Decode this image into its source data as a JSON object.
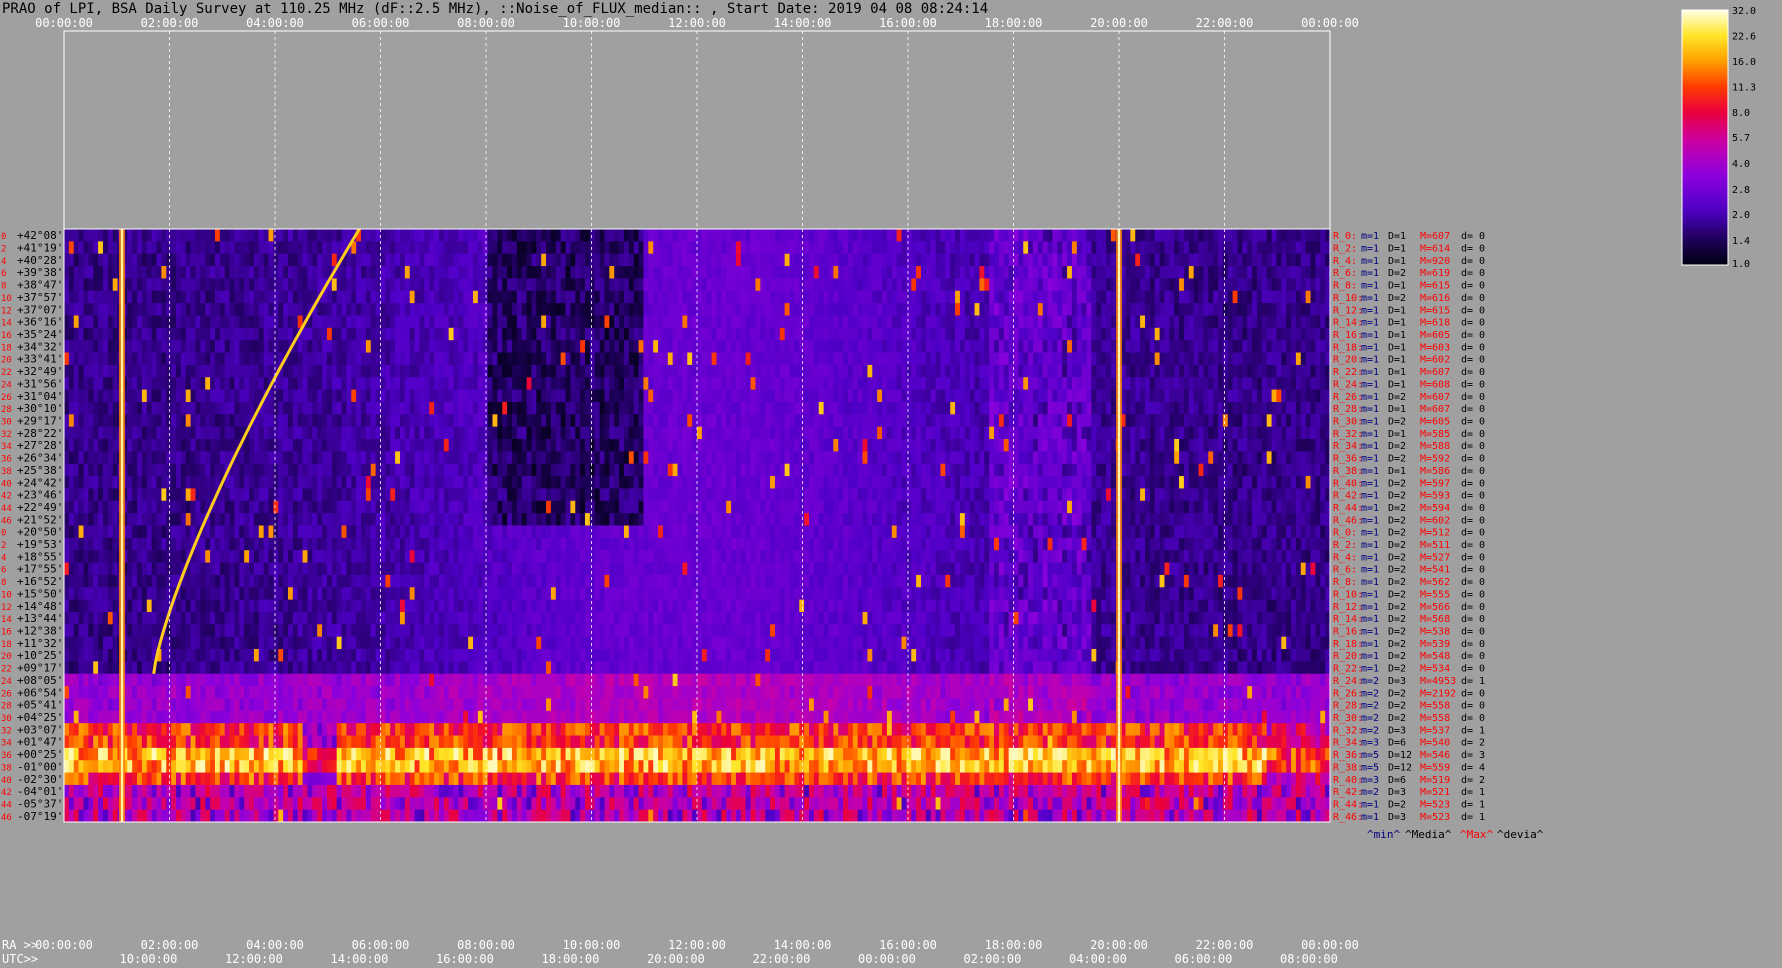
{
  "title": "PRAO of LPI, BSA Daily Survey at 110.25 MHz (dF::2.5 MHz), ::Noise_of_FLUX_median:: , Start Date: 2019 04 08 08:24:14",
  "chart_data": {
    "type": "heatmap",
    "title": "PRAO of LPI, BSA Daily Survey at 110.25 MHz (dF::2.5 MHz), ::Noise_of_FLUX_median:: , Start Date: 2019 04 08 08:24:14",
    "x_top_ticks": [
      "00:00:00",
      "02:00:00",
      "04:00:00",
      "06:00:00",
      "08:00:00",
      "10:00:00",
      "12:00:00",
      "14:00:00",
      "16:00:00",
      "18:00:00",
      "20:00:00",
      "22:00:00",
      "00:00:00"
    ],
    "ra_label": "RA >>",
    "ra_ticks": [
      "00:00:00",
      "02:00:00",
      "04:00:00",
      "06:00:00",
      "08:00:00",
      "10:00:00",
      "12:00:00",
      "14:00:00",
      "16:00:00",
      "18:00:00",
      "20:00:00",
      "22:00:00",
      "00:00:00"
    ],
    "utc_label": "UTC>>",
    "utc_ticks": [
      "10:00:00",
      "12:00:00",
      "14:00:00",
      "16:00:00",
      "18:00:00",
      "20:00:00",
      "22:00:00",
      "00:00:00",
      "02:00:00",
      "04:00:00",
      "06:00:00",
      "08:00:00"
    ],
    "row_index_labels": [
      "0",
      "2",
      "4",
      "6",
      "8",
      "10",
      "12",
      "14",
      "16",
      "18",
      "20",
      "22",
      "24",
      "26",
      "28",
      "30",
      "32",
      "34",
      "36",
      "38",
      "40",
      "42",
      "44",
      "46",
      "0",
      "2",
      "4",
      "6",
      "8",
      "10",
      "12",
      "14",
      "16",
      "18",
      "20",
      "22",
      "24",
      "26",
      "28",
      "30",
      "32",
      "34",
      "36",
      "38",
      "40",
      "42",
      "44",
      "46"
    ],
    "declinations": [
      "+42°08'",
      "+41°19'",
      "+40°28'",
      "+39°38'",
      "+38°47'",
      "+37°57'",
      "+37°07'",
      "+36°16'",
      "+35°24'",
      "+34°32'",
      "+33°41'",
      "+32°49'",
      "+31°56'",
      "+31°04'",
      "+30°10'",
      "+29°17'",
      "+28°22'",
      "+27°28'",
      "+26°34'",
      "+25°38'",
      "+24°42'",
      "+23°46'",
      "+22°49'",
      "+21°52'",
      "+20°50'",
      "+19°53'",
      "+18°55'",
      "+17°55'",
      "+16°52'",
      "+15°50'",
      "+14°48'",
      "+13°44'",
      "+12°38'",
      "+11°32'",
      "+10°25'",
      "+09°17'",
      "+08°05'",
      "+06°54'",
      "+05°41'",
      "+04°25'",
      "+03°07'",
      "+01°47'",
      "+00°25'",
      "-01°00'",
      "-02°30'",
      "-04°01'",
      "-05°37'",
      "-07°19'"
    ],
    "row_stats": [
      {
        "r": "R_0:",
        "m": "m=1",
        "D": "D=1",
        "M": "M=607",
        "d": "d= 0"
      },
      {
        "r": "R_2:",
        "m": "m=1",
        "D": "D=1",
        "M": "M=614",
        "d": "d= 0"
      },
      {
        "r": "R_4:",
        "m": "m=1",
        "D": "D=1",
        "M": "M=920",
        "d": "d= 0"
      },
      {
        "r": "R_6:",
        "m": "m=1",
        "D": "D=2",
        "M": "M=619",
        "d": "d= 0"
      },
      {
        "r": "R_8:",
        "m": "m=1",
        "D": "D=1",
        "M": "M=615",
        "d": "d= 0"
      },
      {
        "r": "R_10:",
        "m": "m=1",
        "D": "D=2",
        "M": "M=616",
        "d": "d= 0"
      },
      {
        "r": "R_12:",
        "m": "m=1",
        "D": "D=1",
        "M": "M=615",
        "d": "d= 0"
      },
      {
        "r": "R_14:",
        "m": "m=1",
        "D": "D=1",
        "M": "M=618",
        "d": "d= 0"
      },
      {
        "r": "R_16:",
        "m": "m=1",
        "D": "D=1",
        "M": "M=605",
        "d": "d= 0"
      },
      {
        "r": "R_18:",
        "m": "m=1",
        "D": "D=1",
        "M": "M=603",
        "d": "d= 0"
      },
      {
        "r": "R_20:",
        "m": "m=1",
        "D": "D=1",
        "M": "M=602",
        "d": "d= 0"
      },
      {
        "r": "R_22:",
        "m": "m=1",
        "D": "D=1",
        "M": "M=607",
        "d": "d= 0"
      },
      {
        "r": "R_24:",
        "m": "m=1",
        "D": "D=1",
        "M": "M=608",
        "d": "d= 0"
      },
      {
        "r": "R_26:",
        "m": "m=1",
        "D": "D=2",
        "M": "M=607",
        "d": "d= 0"
      },
      {
        "r": "R_28:",
        "m": "m=1",
        "D": "D=1",
        "M": "M=607",
        "d": "d= 0"
      },
      {
        "r": "R_30:",
        "m": "m=1",
        "D": "D=2",
        "M": "M=605",
        "d": "d= 0"
      },
      {
        "r": "R_32:",
        "m": "m=1",
        "D": "D=1",
        "M": "M=585",
        "d": "d= 0"
      },
      {
        "r": "R_34:",
        "m": "m=1",
        "D": "D=2",
        "M": "M=588",
        "d": "d= 0"
      },
      {
        "r": "R_36:",
        "m": "m=1",
        "D": "D=2",
        "M": "M=592",
        "d": "d= 0"
      },
      {
        "r": "R_38:",
        "m": "m=1",
        "D": "D=1",
        "M": "M=586",
        "d": "d= 0"
      },
      {
        "r": "R_40:",
        "m": "m=1",
        "D": "D=2",
        "M": "M=597",
        "d": "d= 0"
      },
      {
        "r": "R_42:",
        "m": "m=1",
        "D": "D=2",
        "M": "M=593",
        "d": "d= 0"
      },
      {
        "r": "R_44:",
        "m": "m=1",
        "D": "D=2",
        "M": "M=594",
        "d": "d= 0"
      },
      {
        "r": "R_46:",
        "m": "m=1",
        "D": "D=2",
        "M": "M=602",
        "d": "d= 0"
      },
      {
        "r": "R_0:",
        "m": "m=1",
        "D": "D=2",
        "M": "M=512",
        "d": "d= 0"
      },
      {
        "r": "R_2:",
        "m": "m=1",
        "D": "D=2",
        "M": "M=511",
        "d": "d= 0"
      },
      {
        "r": "R_4:",
        "m": "m=1",
        "D": "D=2",
        "M": "M=527",
        "d": "d= 0"
      },
      {
        "r": "R_6:",
        "m": "m=1",
        "D": "D=2",
        "M": "M=541",
        "d": "d= 0"
      },
      {
        "r": "R_8:",
        "m": "m=1",
        "D": "D=2",
        "M": "M=562",
        "d": "d= 0"
      },
      {
        "r": "R_10:",
        "m": "m=1",
        "D": "D=2",
        "M": "M=555",
        "d": "d= 0"
      },
      {
        "r": "R_12:",
        "m": "m=1",
        "D": "D=2",
        "M": "M=566",
        "d": "d= 0"
      },
      {
        "r": "R_14:",
        "m": "m=1",
        "D": "D=2",
        "M": "M=568",
        "d": "d= 0"
      },
      {
        "r": "R_16:",
        "m": "m=1",
        "D": "D=2",
        "M": "M=538",
        "d": "d= 0"
      },
      {
        "r": "R_18:",
        "m": "m=1",
        "D": "D=2",
        "M": "M=539",
        "d": "d= 0"
      },
      {
        "r": "R_20:",
        "m": "m=1",
        "D": "D=2",
        "M": "M=548",
        "d": "d= 0"
      },
      {
        "r": "R_22:",
        "m": "m=1",
        "D": "D=2",
        "M": "M=534",
        "d": "d= 0"
      },
      {
        "r": "R_24:",
        "m": "m=2",
        "D": "D=3",
        "M": "M=4953",
        "d": "d= 1"
      },
      {
        "r": "R_26:",
        "m": "m=2",
        "D": "D=2",
        "M": "M=2192",
        "d": "d= 0"
      },
      {
        "r": "R_28:",
        "m": "m=2",
        "D": "D=2",
        "M": "M=558",
        "d": "d= 0"
      },
      {
        "r": "R_30:",
        "m": "m=2",
        "D": "D=2",
        "M": "M=558",
        "d": "d= 0"
      },
      {
        "r": "R_32:",
        "m": "m=2",
        "D": "D=3",
        "M": "M=537",
        "d": "d= 1"
      },
      {
        "r": "R_34:",
        "m": "m=3",
        "D": "D=6",
        "M": "M=540",
        "d": "d= 2"
      },
      {
        "r": "R_36:",
        "m": "m=5",
        "D": "D=12",
        "M": "M=546",
        "d": "d= 3"
      },
      {
        "r": "R_38:",
        "m": "m=5",
        "D": "D=12",
        "M": "M=559",
        "d": "d= 4"
      },
      {
        "r": "R_40:",
        "m": "m=3",
        "D": "D=6",
        "M": "M=519",
        "d": "d= 2"
      },
      {
        "r": "R_42:",
        "m": "m=2",
        "D": "D=3",
        "M": "M=521",
        "d": "d= 1"
      },
      {
        "r": "R_44:",
        "m": "m=1",
        "D": "D=2",
        "M": "M=523",
        "d": "d= 1"
      },
      {
        "r": "R_46:",
        "m": "m=1",
        "D": "D=3",
        "M": "M=523",
        "d": "d= 1"
      }
    ],
    "stats_footer": {
      "min": "^min^",
      "media": "^Media^",
      "max": "^Max^",
      "devia": "^devia^"
    },
    "colorbar": {
      "ticks": [
        "32.0",
        "22.6",
        "16.0",
        "11.3",
        "8.0",
        "5.7",
        "4.0",
        "2.8",
        "2.0",
        "1.4",
        "1.0"
      ],
      "values": [
        32.0,
        22.6,
        16.0,
        11.3,
        8.0,
        5.7,
        4.0,
        2.8,
        2.0,
        1.4,
        1.0
      ],
      "scale": "log"
    },
    "colors": {
      "background": "#a0a0a0",
      "dec_label": "#000000",
      "row_index": "#ff0000",
      "stat_r": "#ff0000",
      "stat_m": "#000080",
      "stat_D": "#000000",
      "stat_M": "#ff0000",
      "stat_d": "#000000",
      "footer_min": "#000080",
      "footer_media": "#000000",
      "footer_max": "#ff0000",
      "footer_devia": "#000000",
      "tick_text": "#ffffff"
    },
    "features": {
      "bright_band_rows": [
        40,
        41,
        42,
        43,
        44
      ],
      "vertical_source_ra_hours": [
        1.1,
        20.0
      ],
      "diagonal_track": {
        "start_ra": 1.7,
        "end_ra": 5.6
      }
    }
  }
}
